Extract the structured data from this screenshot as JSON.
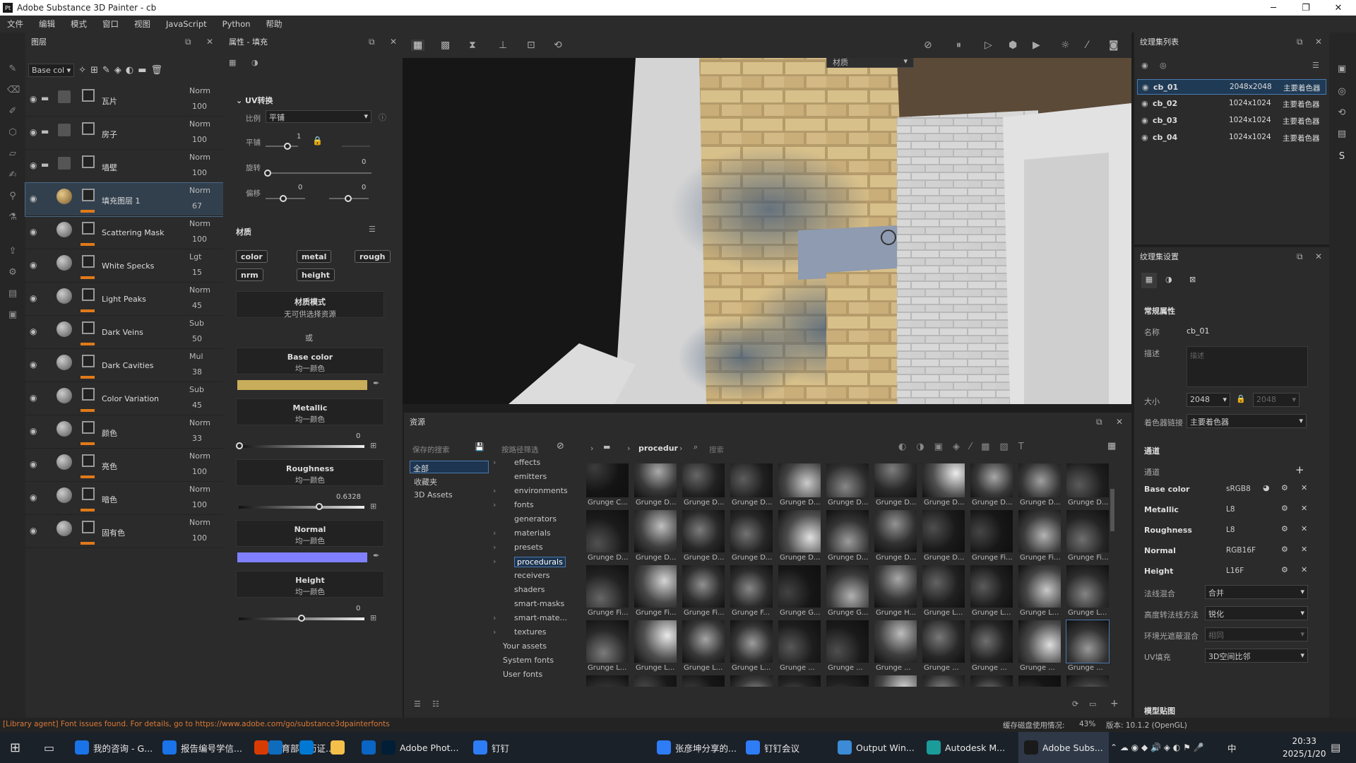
{
  "app": {
    "title": "Adobe Substance 3D Painter - cb",
    "logo": "Pt"
  },
  "menu": [
    "文件",
    "编辑",
    "模式",
    "窗口",
    "视图",
    "JavaScript",
    "Python",
    "帮助"
  ],
  "layers_panel": {
    "title": "图层",
    "channel_select": "Base col",
    "layers": [
      {
        "name": "瓦片",
        "blend": "Norm",
        "opacity": "100",
        "folder": true
      },
      {
        "name": "房子",
        "blend": "Norm",
        "opacity": "100",
        "folder": true
      },
      {
        "name": "墙壁",
        "blend": "Norm",
        "opacity": "100",
        "folder": true
      },
      {
        "name": "填充图层 1",
        "blend": "Norm",
        "opacity": "67",
        "active": true
      },
      {
        "name": "Scattering Mask",
        "blend": "Norm",
        "opacity": "100"
      },
      {
        "name": "White Specks",
        "blend": "Lgt",
        "opacity": "15"
      },
      {
        "name": "Light Peaks",
        "blend": "Norm",
        "opacity": "45"
      },
      {
        "name": "Dark Veins",
        "blend": "Sub",
        "opacity": "50"
      },
      {
        "name": "Dark Cavities",
        "blend": "Mul",
        "opacity": "38"
      },
      {
        "name": "Color Variation",
        "blend": "Sub",
        "opacity": "45"
      },
      {
        "name": "颜色",
        "blend": "Norm",
        "opacity": "33"
      },
      {
        "name": "亮色",
        "blend": "Norm",
        "opacity": "100"
      },
      {
        "name": "暗色",
        "blend": "Norm",
        "opacity": "100"
      },
      {
        "name": "固有色",
        "blend": "Norm",
        "opacity": "100"
      }
    ]
  },
  "props_panel": {
    "title": "属性 - 填充",
    "uv_title": "UV转换",
    "scale_label": "比例",
    "scale_value": "平铺",
    "tile_label": "平铺",
    "tile_value": "1",
    "rotate_label": "旋转",
    "rotate_value": "0",
    "offset_label": "偏移",
    "offset_value_1": "0",
    "offset_value_2": "0",
    "material_title": "材质",
    "chips": [
      "color",
      "metal",
      "rough",
      "nrm",
      "height"
    ],
    "material_mode": "材质模式",
    "material_mode_sub": "无可供选择资源",
    "or": "或",
    "base_color": "Base color",
    "uniform": "均一颜色",
    "metallic": "Metallic",
    "metallic_value": "0",
    "roughness": "Roughness",
    "roughness_value": "0.6328",
    "normal": "Normal",
    "height": "Height",
    "height_value": "0",
    "base_color_hex": "#c8ad5a",
    "normal_color_hex": "#8080ff"
  },
  "viewport": {
    "dropdown": "材质"
  },
  "assets": {
    "title": "资源",
    "saved_search": "保存的搜索",
    "filter_by_path": "按路径筛选",
    "left_items": [
      "全部",
      "收藏夹",
      "3D Assets"
    ],
    "tree": [
      "effects",
      "emitters",
      "environments",
      "fonts",
      "generators",
      "materials",
      "presets",
      "procedurals",
      "receivers",
      "shaders",
      "smart-masks",
      "smart-mate...",
      "textures",
      "Your assets",
      "System fonts",
      "User fonts"
    ],
    "path": "procedur",
    "search_placeholder": "搜索",
    "thumbs": [
      "Grunge C...",
      "Grunge D...",
      "Grunge D...",
      "Grunge D...",
      "Grunge D...",
      "Grunge D...",
      "Grunge D...",
      "Grunge D...",
      "Grunge D...",
      "Grunge D...",
      "Grunge D...",
      "Grunge D...",
      "Grunge D...",
      "Grunge D...",
      "Grunge D...",
      "Grunge D...",
      "Grunge D...",
      "Grunge D...",
      "Grunge D...",
      "Grunge Fi...",
      "Grunge Fi...",
      "Grunge Fi...",
      "Grunge Fi...",
      "Grunge Fi...",
      "Grunge Fi...",
      "Grunge F...",
      "Grunge G...",
      "Grunge G...",
      "Grunge H...",
      "Grunge L...",
      "Grunge L...",
      "Grunge L...",
      "Grunge L...",
      "Grunge L...",
      "Grunge L...",
      "Grunge L...",
      "Grunge L...",
      "Grunge ...",
      "Grunge ...",
      "Grunge ...",
      "Grunge ...",
      "Grunge ...",
      "Grunge ...",
      "Grunge ..."
    ]
  },
  "texture_list": {
    "title": "纹理集列表",
    "items": [
      {
        "name": "cb_01",
        "res": "2048x2048",
        "shader": "主要着色器"
      },
      {
        "name": "cb_02",
        "res": "1024x1024",
        "shader": "主要着色器"
      },
      {
        "name": "cb_03",
        "res": "1024x1024",
        "shader": "主要着色器"
      },
      {
        "name": "cb_04",
        "res": "1024x1024",
        "shader": "主要着色器"
      }
    ]
  },
  "texture_settings": {
    "title": "纹理集设置",
    "general": "常规属性",
    "name_label": "名称",
    "name_value": "cb_01",
    "desc_label": "描述",
    "desc_placeholder": "描述",
    "size_label": "大小",
    "size_value": "2048",
    "size_value_2": "2048",
    "shader_link_label": "着色器链接",
    "shader_link_value": "主要着色器",
    "channels_title": "通道",
    "channels_label": "通道",
    "channels": [
      {
        "name": "Base color",
        "fmt": "sRGB8"
      },
      {
        "name": "Metallic",
        "fmt": "L8"
      },
      {
        "name": "Roughness",
        "fmt": "L8"
      },
      {
        "name": "Normal",
        "fmt": "RGB16F"
      },
      {
        "name": "Height",
        "fmt": "L16F"
      }
    ],
    "normal_mix_label": "法线混合",
    "normal_mix_value": "合并",
    "height2normal_label": "高度转法线方法",
    "height2normal_value": "锐化",
    "ao_mix_label": "环境光遮蔽混合",
    "ao_mix_value": "相同",
    "uv_pad_label": "UV填充",
    "uv_pad_value": "3D空间比邻",
    "model_maps": "模型贴图"
  },
  "status": {
    "warning": "[Library agent] Font issues found. For details, go to https://www.adobe.com/go/substance3dpainterfonts",
    "cache": "缓存磁盘使用情况:",
    "percent": "43%",
    "version": "版本: 10.1.2 (OpenGL)"
  },
  "taskbar": {
    "items": [
      "我的咨询 - G...",
      "报告编号学信...",
      "教育部学历证...",
      "Adobe Phot...",
      "钉钉",
      "张彦坤分享的...",
      "钉钉会议",
      "Output Win...",
      "Autodesk M...",
      "Adobe Subs..."
    ],
    "time": "20:33",
    "date": "2025/1/20",
    "ime": "中"
  },
  "colors": {
    "accent": "#e07a1a",
    "selection": "#32404e"
  }
}
